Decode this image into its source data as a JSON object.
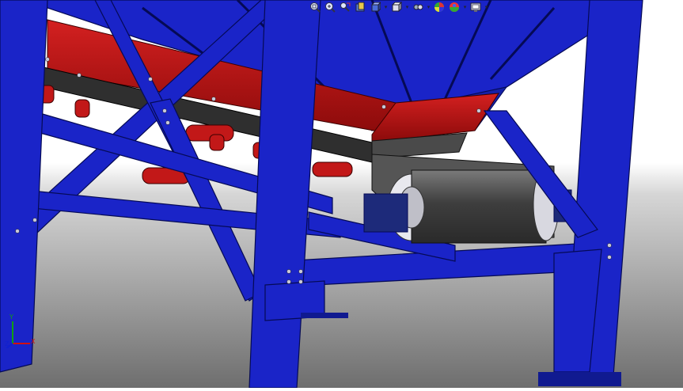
{
  "app": {
    "kind": "cad-3d-viewport"
  },
  "scene": {
    "background_colors": {
      "top": "#ffffff",
      "bottom": "#6e6e6e"
    },
    "structure_color": "#1a24c8",
    "structure_edge_color": "#050a55",
    "conveyor_side_color": "#b51010",
    "belt_color": "#4a4a4a",
    "pulley_rim_color": "#e8e8ee"
  },
  "toolbar": {
    "buttons": [
      {
        "id": "zoom-to-fit",
        "icon": "zoom-to-fit-icon",
        "has_dropdown": false
      },
      {
        "id": "zoom-to-area",
        "icon": "zoom-to-area-icon",
        "has_dropdown": false
      },
      {
        "id": "previous-view",
        "icon": "previous-view-icon",
        "has_dropdown": false
      },
      {
        "id": "section-view",
        "icon": "section-view-icon",
        "has_dropdown": false
      },
      {
        "id": "view-orientation",
        "icon": "view-orientation-icon",
        "has_dropdown": true
      },
      {
        "id": "display-style",
        "icon": "display-style-icon",
        "has_dropdown": true
      },
      {
        "id": "hide-show-items",
        "icon": "hide-show-items-icon",
        "has_dropdown": true
      },
      {
        "id": "edit-appearance",
        "icon": "edit-appearance-icon",
        "has_dropdown": false
      },
      {
        "id": "apply-scene",
        "icon": "apply-scene-icon",
        "has_dropdown": true
      },
      {
        "id": "view-settings",
        "icon": "view-settings-icon",
        "has_dropdown": true
      }
    ]
  },
  "triad": {
    "x_label": "X",
    "y_label": "Y",
    "z_label": "Z",
    "x_color": "#d01010",
    "y_color": "#10a010",
    "z_color": "#1020d0"
  }
}
